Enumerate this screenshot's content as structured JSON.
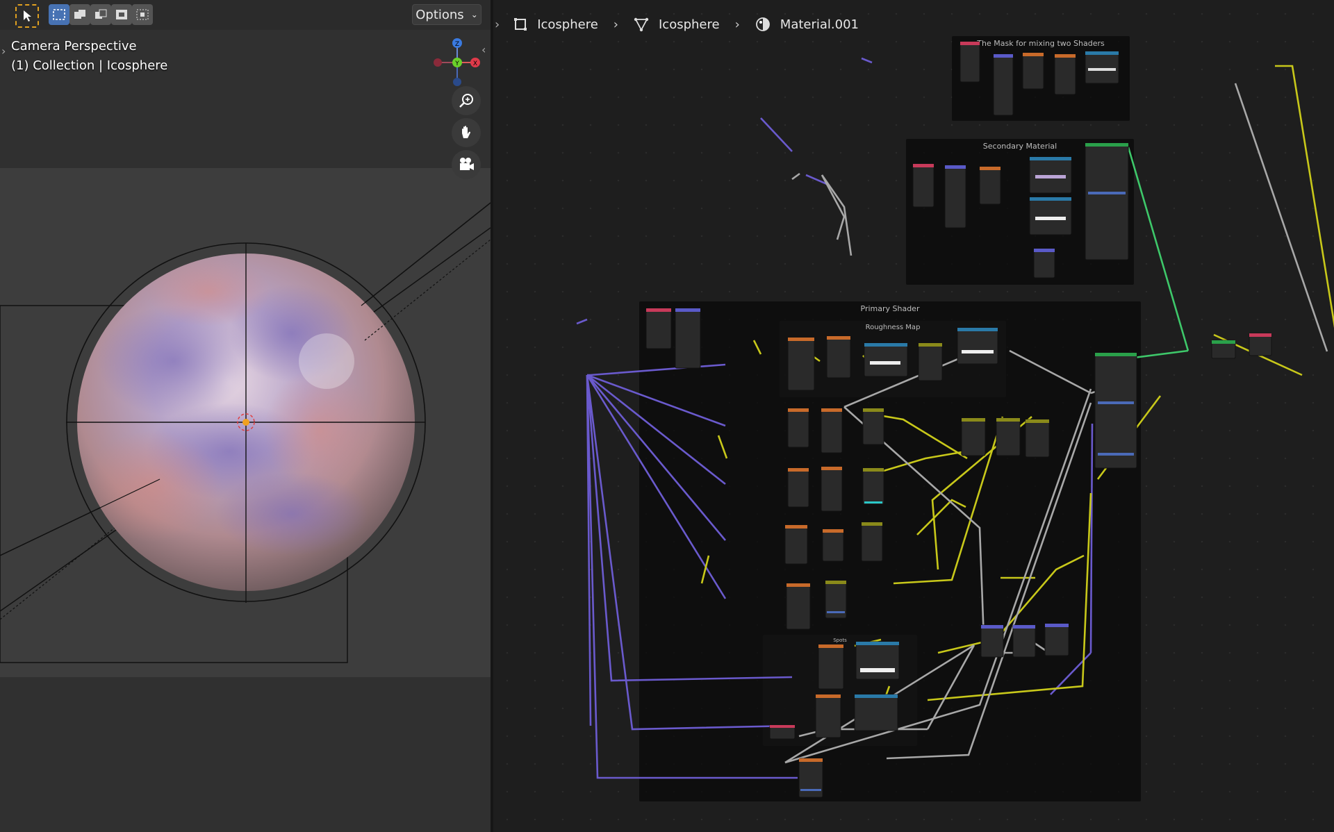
{
  "viewport": {
    "options_label": "Options",
    "overlay_line1": "Camera Perspective",
    "overlay_line2": "(1) Collection | Icosphere",
    "gizmo_axes": {
      "x": "X",
      "y": "Y",
      "z": "Z"
    }
  },
  "node_editor": {
    "breadcrumb": [
      {
        "label": "Icosphere",
        "icon": "object-square-icon"
      },
      {
        "label": "Icosphere",
        "icon": "mesh-data-icon"
      },
      {
        "label": "Material.001",
        "icon": "material-sphere-icon"
      }
    ],
    "frames": {
      "mask": "The Mask for mixing two Shaders",
      "secondary": "Secondary Material",
      "primary": "Primary Shader",
      "roughness": "Roughness Map",
      "spots": "Spots"
    }
  },
  "colors": {
    "link_vector": "#6a5acd",
    "link_float": "#c8c81a",
    "link_color": "#b0b0b0",
    "link_shader": "#3ec86a",
    "header_texture": "#c86a2a",
    "header_converter": "#2a7aa8",
    "header_shader": "#2aa04a",
    "header_input": "#c83a5a",
    "header_vector": "#5a5ac8",
    "header_math": "#8a8a1a"
  }
}
